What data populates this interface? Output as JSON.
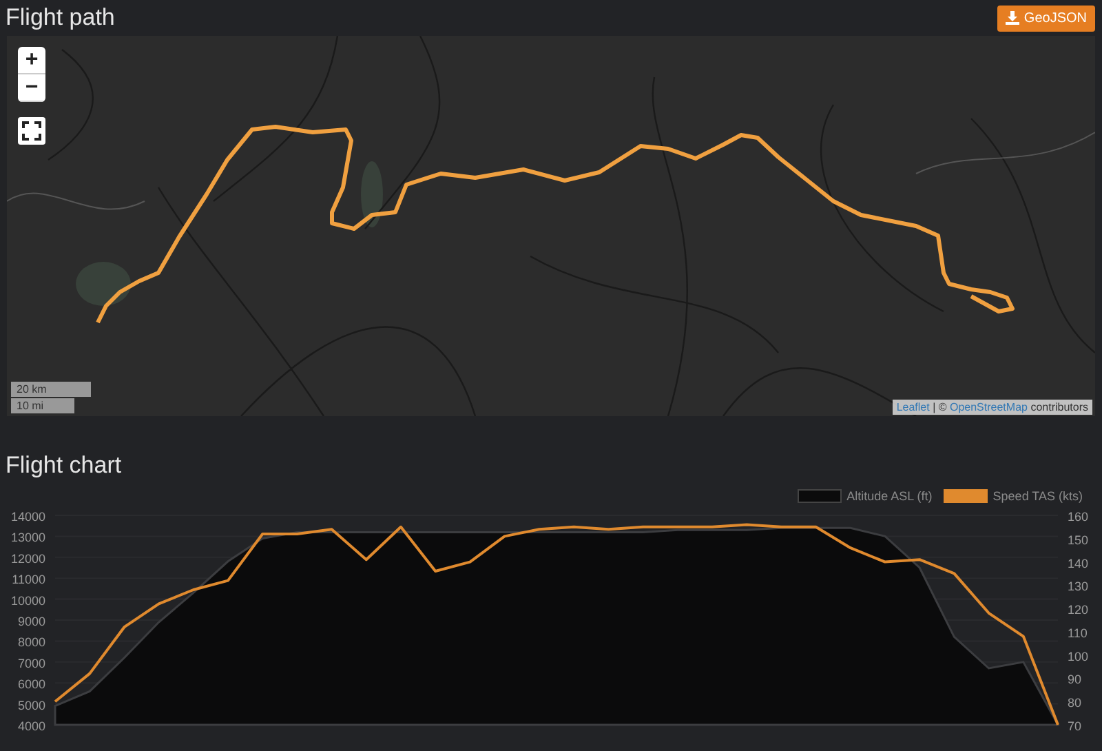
{
  "flight_path": {
    "title": "Flight path",
    "button": {
      "label": "GeoJSON"
    },
    "map": {
      "kind": "picture",
      "zoom_controls": [
        {
          "label": "+"
        },
        {
          "label": "−"
        }
      ],
      "scale": [
        "20 km",
        "10 mi"
      ],
      "attribution": {
        "link_1": "Leaflet",
        "separator": " | © ",
        "link_2": "OpenStreetMap",
        "suffix": " contributors"
      }
    }
  },
  "flight_chart": {
    "title": "Flight chart",
    "chart_data": {
      "type": "line",
      "grid": true,
      "legend": "top-right",
      "ylim": [
        4000,
        14000
      ],
      "yticks": [
        4000,
        5000,
        6000,
        7000,
        8000,
        9000,
        10000,
        11000,
        12000,
        13000,
        14000
      ],
      "y2lim": [
        70,
        160
      ],
      "y2ticks": [
        70,
        80,
        90,
        100,
        110,
        120,
        130,
        140,
        150,
        160
      ],
      "series": [
        {
          "name": "Altitude ASL (ft)",
          "type": "area",
          "color": "#0b0b0c",
          "values": [
            4900,
            5600,
            7200,
            8900,
            10300,
            11800,
            12900,
            13200,
            13200,
            13200,
            13200,
            13200,
            13200,
            13200,
            13200,
            13200,
            13200,
            13200,
            13300,
            13300,
            13300,
            13400,
            13400,
            13400,
            13000,
            11500,
            8200,
            6700,
            7000,
            4000
          ]
        },
        {
          "name": "Speed TAS (kts)",
          "type": "line",
          "axis": "y2",
          "color": "#e08a2e",
          "values": [
            80,
            92,
            112,
            122,
            128,
            132,
            152,
            152,
            154,
            141,
            155,
            136,
            140,
            151,
            154,
            155,
            154,
            155,
            155,
            155,
            156,
            155,
            155,
            146,
            140,
            141,
            135,
            118,
            108,
            70
          ]
        }
      ]
    }
  }
}
